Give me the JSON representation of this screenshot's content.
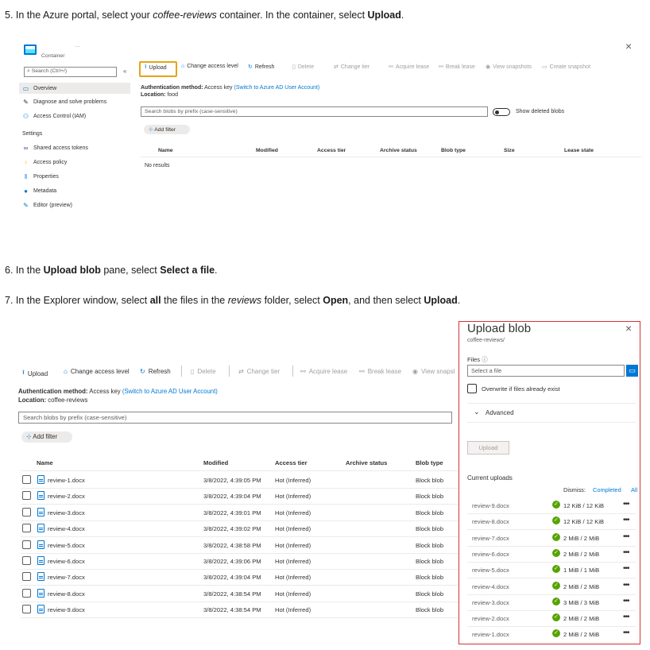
{
  "step5": {
    "pre": "5. In the Azure portal, select your ",
    "em": "coffee-reviews",
    "mid": " container. In the container, select ",
    "bold": "Upload",
    "post": "."
  },
  "step6": {
    "pre": "6. In the ",
    "bold1": "Upload blob",
    "mid": " pane, select ",
    "bold2": "Select a file",
    "post": "."
  },
  "step7": {
    "pre": "7. In the Explorer window, select ",
    "bold1": "all",
    "mid1": " the files in the ",
    "em": "reviews",
    "mid2": " folder, select ",
    "bold2": "Open",
    "mid3": ", and then select ",
    "bold3": "Upload",
    "post": "."
  },
  "shot1": {
    "dots": "...",
    "container_label": "Container",
    "search_placeholder": "Search (Ctrl+/)",
    "collapse": "«",
    "nav": [
      {
        "label": "Overview",
        "icon": "overview-icon"
      },
      {
        "label": "Diagnose and solve problems",
        "icon": "wrench-icon"
      },
      {
        "label": "Access Control (IAM)",
        "icon": "people-icon"
      }
    ],
    "settings_header": "Settings",
    "settings": [
      {
        "label": "Shared access tokens",
        "icon": "link-icon"
      },
      {
        "label": "Access policy",
        "icon": "key-icon"
      },
      {
        "label": "Properties",
        "icon": "properties-icon"
      },
      {
        "label": "Metadata",
        "icon": "info-icon"
      },
      {
        "label": "Editor (preview)",
        "icon": "pencil-icon"
      }
    ],
    "toolbar": {
      "upload": "Upload",
      "change_access": "Change access level",
      "refresh": "Refresh",
      "delete": "Delete",
      "change_tier": "Change tier",
      "acquire": "Acquire lease",
      "break": "Break lease",
      "view_snap": "View snapshots",
      "create_snap": "Create snapshot"
    },
    "auth_label": "Authentication method:",
    "auth_value": "Access key",
    "auth_link": "(Switch to Azure AD User Account)",
    "location_label": "Location:",
    "location_value": "food",
    "search_blobs": "Search blobs by prefix (case-sensitive)",
    "show_deleted": "Show deleted blobs",
    "add_filter": "Add filter",
    "columns": [
      "Name",
      "Modified",
      "Access tier",
      "Archive status",
      "Blob type",
      "Size",
      "Lease state"
    ],
    "no_results": "No results",
    "close": "×"
  },
  "shot2": {
    "toolbar": {
      "upload": "Upload",
      "change_access": "Change access level",
      "refresh": "Refresh",
      "delete": "Delete",
      "change_tier": "Change tier",
      "acquire": "Acquire lease",
      "break": "Break lease",
      "view_snap": "View snapsl"
    },
    "auth_label": "Authentication method:",
    "auth_value": "Access key",
    "auth_link": "(Switch to Azure AD User Account)",
    "location_label": "Location:",
    "location_value": "coffee-reviews",
    "search_blobs": "Search blobs by prefix (case-sensitive)",
    "add_filter": "Add filter",
    "columns": [
      "Name",
      "Modified",
      "Access tier",
      "Archive status",
      "Blob type"
    ],
    "rows": [
      {
        "name": "review-1.docx",
        "modified": "3/8/2022, 4:39:05 PM",
        "tier": "Hot (Inferred)",
        "type": "Block blob"
      },
      {
        "name": "review-2.docx",
        "modified": "3/8/2022, 4:39:04 PM",
        "tier": "Hot (Inferred)",
        "type": "Block blob"
      },
      {
        "name": "review-3.docx",
        "modified": "3/8/2022, 4:39:01 PM",
        "tier": "Hot (Inferred)",
        "type": "Block blob"
      },
      {
        "name": "review-4.docx",
        "modified": "3/8/2022, 4:39:02 PM",
        "tier": "Hot (Inferred)",
        "type": "Block blob"
      },
      {
        "name": "review-5.docx",
        "modified": "3/8/2022, 4:38:58 PM",
        "tier": "Hot (Inferred)",
        "type": "Block blob"
      },
      {
        "name": "review-6.docx",
        "modified": "3/8/2022, 4:39:06 PM",
        "tier": "Hot (Inferred)",
        "type": "Block blob"
      },
      {
        "name": "review-7.docx",
        "modified": "3/8/2022, 4:39:04 PM",
        "tier": "Hot (Inferred)",
        "type": "Block blob"
      },
      {
        "name": "review-8.docx",
        "modified": "3/8/2022, 4:38:54 PM",
        "tier": "Hot (Inferred)",
        "type": "Block blob"
      },
      {
        "name": "review-9.docx",
        "modified": "3/8/2022, 4:38:54 PM",
        "tier": "Hot (Inferred)",
        "type": "Block blob"
      }
    ]
  },
  "pane": {
    "title": "Upload blob",
    "subtitle": "coffee-reviews/",
    "close": "×",
    "files_label": "Files",
    "select_placeholder": "Select a file",
    "overwrite": "Overwrite if files already exist",
    "advanced": "Advanced",
    "upload_button": "Upload",
    "current_uploads": "Current uploads",
    "dismiss": "Dismiss:",
    "completed": "Completed",
    "all": "All",
    "uploads": [
      {
        "file": "review-9.docx",
        "size": "12 KiB / 12 KiB"
      },
      {
        "file": "review-8.docx",
        "size": "12 KiB / 12 KiB"
      },
      {
        "file": "review-7.docx",
        "size": "2 MiB / 2 MiB"
      },
      {
        "file": "review-6.docx",
        "size": "2 MiB / 2 MiB"
      },
      {
        "file": "review-5.docx",
        "size": "1 MiB / 1 MiB"
      },
      {
        "file": "review-4.docx",
        "size": "2 MiB / 2 MiB"
      },
      {
        "file": "review-3.docx",
        "size": "3 MiB / 3 MiB"
      },
      {
        "file": "review-2.docx",
        "size": "2 MiB / 2 MiB"
      },
      {
        "file": "review-1.docx",
        "size": "2 MiB / 2 MiB"
      }
    ]
  }
}
